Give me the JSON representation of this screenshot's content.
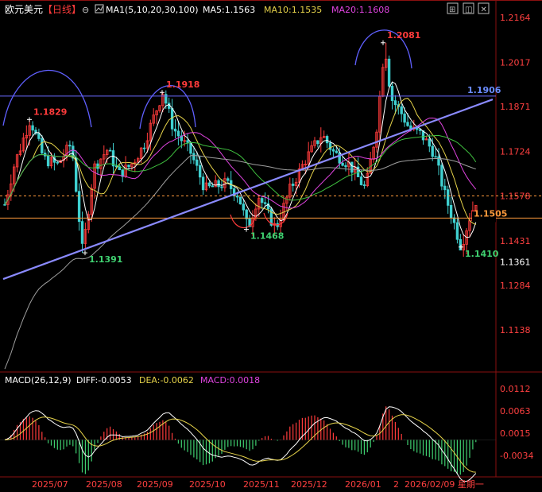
{
  "header": {
    "symbol": "欧元美元",
    "period": "【日线】",
    "ma_label": "MA1(5,10,20,30,100)",
    "ma5": "MA5:1.1563",
    "ma10": "MA10:1.1535",
    "ma20": "MA20:1.1608",
    "colors": {
      "symbol": "#ffffff",
      "period": "#ff3b3b",
      "ma5": "#ffffff",
      "ma10": "#e6d34a",
      "ma20": "#e044e0",
      "ma30": "#3fc03f",
      "ma100": "#a0a0a0"
    }
  },
  "macd_header": {
    "label": "MACD(26,12,9)",
    "diff": "DIFF:-0.0053",
    "dea": "DEA:-0.0062",
    "macd": "MACD:0.0018"
  },
  "price_axis": [
    "1.2164",
    "1.2017",
    "1.1871",
    "1.1724",
    "1.1578",
    "1.1431",
    "1.1284",
    "1.1138"
  ],
  "current_price": "1.1361",
  "macd_axis": [
    "0.0112",
    "0.0063",
    "0.0015",
    "-0.0034"
  ],
  "date_axis": [
    "2025/07",
    "2025/08",
    "2025/09",
    "2025/10",
    "2025/11",
    "2025/12",
    "2026/01",
    "2026/02/09 星期一"
  ],
  "date_axis_partial": "2",
  "chart_data": {
    "type": "candlestick",
    "price_range": [
      1.105,
      1.22
    ],
    "annotations": [
      {
        "label": "1.1829",
        "price": 1.1829,
        "kind": "high",
        "color": "#ff3b3b"
      },
      {
        "label": "1.1918",
        "price": 1.1918,
        "kind": "high",
        "color": "#ff3b3b"
      },
      {
        "label": "1.2081",
        "price": 1.2081,
        "kind": "high",
        "color": "#ff3b3b"
      },
      {
        "label": "1.1391",
        "price": 1.1391,
        "kind": "low",
        "color": "#3fd070"
      },
      {
        "label": "1.1468",
        "price": 1.1468,
        "kind": "low",
        "color": "#3fd070"
      },
      {
        "label": "1.1410",
        "price": 1.141,
        "kind": "low",
        "color": "#3fd070"
      },
      {
        "label": "1.1906",
        "price": 1.1906,
        "kind": "trendline-end",
        "color": "#6b8cff"
      },
      {
        "label": "1.1505",
        "price": 1.1505,
        "kind": "horizontal-level",
        "color": "#ff9a3c"
      }
    ],
    "resistance_level": 1.1906,
    "support_level": 1.1505,
    "last_price_dashed": 1.1578,
    "macd_range": [
      -0.0075,
      0.013
    ]
  }
}
